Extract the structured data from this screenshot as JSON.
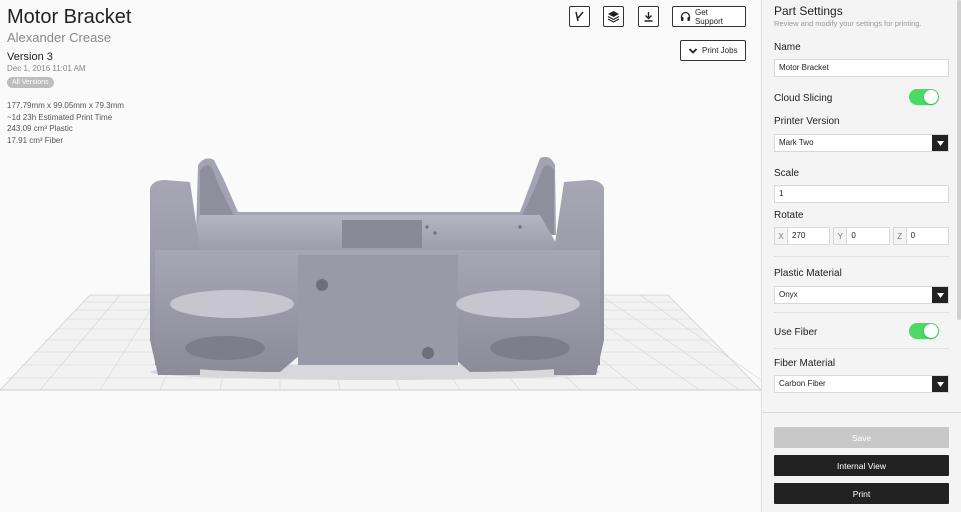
{
  "part": {
    "title": "Motor Bracket",
    "author": "Alexander Crease",
    "version": "Version 3",
    "date": "Dec 1, 2016 11:01 AM",
    "all_versions_label": "All Versions",
    "dimensions": "177.79mm x 99.05mm x 79.3mm",
    "print_time": "~1d 23h Estimated Print Time",
    "plastic": "243.09 cm³ Plastic",
    "fiber": "17.91 cm³ Fiber"
  },
  "toolbar": {
    "get_support_label": "Get Support",
    "print_jobs_label": "Print Jobs",
    "icons": [
      "branch-icon",
      "layers-icon",
      "download-icon",
      "headset-icon",
      "chevron-down-icon"
    ]
  },
  "settings": {
    "title": "Part Settings",
    "subtitle": "Review and modify your settings for printing.",
    "name_label": "Name",
    "name_value": "Motor Bracket",
    "cloud_slicing_label": "Cloud Slicing",
    "cloud_slicing_on": true,
    "printer_version_label": "Printer Version",
    "printer_version_value": "Mark Two",
    "scale_label": "Scale",
    "scale_value": "1",
    "rotate_label": "Rotate",
    "rotate_x_label": "X",
    "rotate_x": "270",
    "rotate_y_label": "Y",
    "rotate_y": "0",
    "rotate_z_label": "Z",
    "rotate_z": "0",
    "plastic_material_label": "Plastic Material",
    "plastic_material_value": "Onyx",
    "use_fiber_label": "Use Fiber",
    "use_fiber_on": true,
    "fiber_material_label": "Fiber Material",
    "fiber_material_value": "Carbon Fiber"
  },
  "actions": {
    "save_label": "Save",
    "internal_view_label": "Internal View",
    "print_label": "Print"
  },
  "colors": {
    "toggle_on": "#4cd964",
    "dark_button": "#222222",
    "model": "#9b9aa8"
  }
}
